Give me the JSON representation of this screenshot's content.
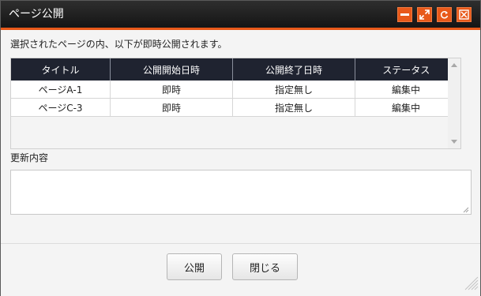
{
  "window": {
    "title": "ページ公開"
  },
  "notice": "選択されたページの内、以下が即時公開されます。",
  "table": {
    "headers": [
      "タイトル",
      "公開開始日時",
      "公開終了日時",
      "ステータス"
    ],
    "rows": [
      [
        "ページA-1",
        "即時",
        "指定無し",
        "編集中"
      ],
      [
        "ページC-3",
        "即時",
        "指定無し",
        "編集中"
      ]
    ]
  },
  "update_label": "更新内容",
  "update_value": "",
  "buttons": {
    "publish": "公開",
    "close": "閉じる"
  },
  "titlebar_icons": [
    "minimize-icon",
    "maximize-icon",
    "refresh-icon",
    "close-icon"
  ],
  "colors": {
    "accent": "#e8591a",
    "titlebar": "#1a1a1a",
    "table_header": "#1f2330"
  }
}
